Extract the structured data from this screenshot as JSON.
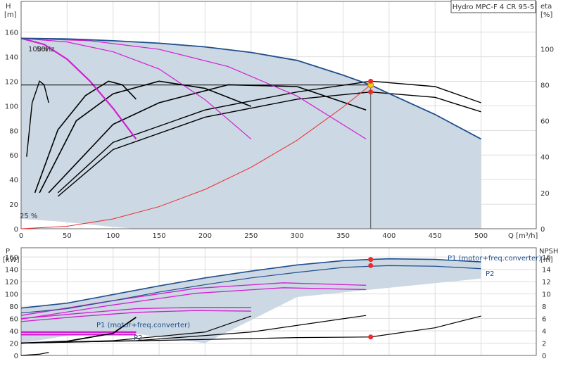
{
  "chart_data": [
    {
      "type": "line",
      "title": "Hydro MPC-F 4 CR 95-5",
      "xlabel": "Q [m³/h]",
      "ylabel_left_name": "H",
      "ylabel_left_unit": "[m]",
      "ylabel_right_name": "eta",
      "ylabel_right_unit": "[%]",
      "xlim": [
        0,
        560
      ],
      "ylim": [
        0,
        185
      ],
      "xticks": [
        0,
        50,
        100,
        150,
        200,
        250,
        300,
        350,
        400,
        450,
        500
      ],
      "yticks_left": [
        0,
        20,
        40,
        60,
        80,
        100,
        120,
        140,
        160
      ],
      "yticks_right": [
        0,
        20,
        40,
        60,
        80,
        100
      ],
      "grid": true,
      "annotations": {
        "speed_100": "100%",
        "freq_50": "50Hz",
        "speed_25": "25 %"
      },
      "max_curve": {
        "x": [
          0,
          50,
          100,
          150,
          200,
          250,
          300,
          350,
          380,
          400,
          450,
          500
        ],
        "y": [
          155,
          154.5,
          153,
          151,
          148,
          143.5,
          137,
          125,
          117,
          110,
          93,
          73
        ]
      },
      "min_curve": {
        "x": [
          0,
          10,
          20,
          30,
          40,
          60,
          80,
          100,
          125
        ],
        "y": [
          8,
          7.5,
          7,
          6.5,
          6,
          4.5,
          3,
          1.5,
          0
        ]
      },
      "pump_curves": [
        {
          "x": [
            0,
            25,
            50,
            75,
            100,
            125
          ],
          "y": [
            155,
            150,
            138,
            120,
            98,
            73
          ]
        },
        {
          "x": [
            0,
            50,
            100,
            150,
            200,
            250
          ],
          "y": [
            155,
            152,
            144,
            130,
            105,
            73
          ]
        },
        {
          "x": [
            0,
            75,
            150,
            225,
            300,
            375
          ],
          "y": [
            155,
            153,
            146,
            132,
            108,
            73
          ]
        }
      ],
      "system_curve": {
        "x": [
          0,
          50,
          100,
          150,
          200,
          250,
          300,
          350,
          380
        ],
        "y": [
          0,
          2,
          8,
          18,
          32,
          50,
          72,
          99,
          117
        ]
      },
      "setpoint_H": 117,
      "duty_point": {
        "Q": 380,
        "H": 117
      },
      "eta_curves": [
        {
          "x": [
            15,
            40,
            70,
            95,
            110,
            125
          ],
          "y": [
            20,
            55,
            74,
            82,
            80,
            72
          ]
        },
        {
          "x": [
            20,
            60,
            100,
            150,
            200,
            250
          ],
          "y": [
            20,
            60,
            75,
            82,
            78,
            68
          ]
        },
        {
          "x": [
            30,
            100,
            150,
            225,
            300,
            375
          ],
          "y": [
            20,
            58,
            70,
            80,
            79,
            66
          ]
        },
        {
          "x": [
            40,
            100,
            200,
            300,
            380,
            450,
            500
          ],
          "y": [
            20,
            48,
            66,
            76,
            82,
            79,
            70
          ]
        },
        {
          "x": [
            40,
            100,
            200,
            300,
            380,
            450,
            500
          ],
          "y": [
            18,
            44,
            62,
            72,
            76,
            73,
            65
          ]
        },
        {
          "x": [
            6,
            12,
            20,
            25,
            30
          ],
          "y": [
            40,
            70,
            82,
            80,
            70
          ]
        }
      ],
      "eta_duty_points": [
        82,
        76
      ]
    },
    {
      "type": "line",
      "xlabel": "",
      "ylabel_left_name": "P",
      "ylabel_left_unit": "[kW]",
      "ylabel_right_name": "NPSH",
      "ylabel_right_unit": "[m]",
      "xlim": [
        0,
        560
      ],
      "ylim": [
        0,
        175
      ],
      "yticks_left": [
        0,
        20,
        40,
        60,
        80,
        100,
        120,
        140,
        160
      ],
      "yticks_right": [
        0,
        2,
        4,
        6,
        8,
        10,
        12,
        14,
        16
      ],
      "grid": true,
      "label_p1_main": "P1 (motor+freq.converter)",
      "label_p2_main": "P2",
      "label_p1_small": "P1 (motor+freq.converter)",
      "label_p2_small": "P2",
      "p1_curve": {
        "x": [
          0,
          50,
          100,
          150,
          200,
          250,
          300,
          350,
          380,
          400,
          450,
          500
        ],
        "y": [
          77,
          85,
          99,
          113,
          126,
          137,
          147,
          154,
          156,
          157,
          156,
          152
        ]
      },
      "p2_curve": {
        "x": [
          0,
          50,
          100,
          150,
          200,
          250,
          300,
          350,
          380,
          400,
          450,
          500
        ],
        "y": [
          69,
          76,
          89,
          103,
          115,
          126,
          135,
          143,
          145,
          146,
          145,
          141
        ]
      },
      "p1_min_curve": {
        "x": [
          0,
          50,
          100,
          125
        ],
        "y": [
          20,
          32,
          35,
          35
        ]
      },
      "power_curves_mid": [
        {
          "x": [
            0,
            60,
            125,
            190,
            250
          ],
          "y": [
            60,
            68,
            76,
            78,
            78
          ]
        },
        {
          "x": [
            0,
            60,
            125,
            190,
            250
          ],
          "y": [
            55,
            63,
            70,
            73,
            72
          ]
        },
        {
          "x": [
            0,
            95,
            190,
            285,
            375
          ],
          "y": [
            65,
            88,
            109,
            118,
            114
          ]
        },
        {
          "x": [
            0,
            95,
            190,
            285,
            375
          ],
          "y": [
            59,
            81,
            101,
            110,
            107
          ]
        },
        {
          "x": [
            0,
            50,
            100,
            125
          ],
          "y": [
            38,
            38,
            38,
            38
          ]
        },
        {
          "x": [
            0,
            50,
            100,
            125
          ],
          "y": [
            34,
            34,
            34,
            34
          ]
        }
      ],
      "npsh_curves": [
        {
          "x": [
            0,
            50,
            100,
            125
          ],
          "y": [
            2,
            2.3,
            3.6,
            6.2
          ]
        },
        {
          "x": [
            0,
            100,
            200,
            250
          ],
          "y": [
            2,
            2.4,
            3.8,
            6.4
          ]
        },
        {
          "x": [
            0,
            125,
            250,
            375
          ],
          "y": [
            2,
            2.4,
            3.8,
            6.5
          ]
        },
        {
          "x": [
            0,
            100,
            200,
            300,
            380,
            450,
            500
          ],
          "y": [
            2,
            2.3,
            2.6,
            2.9,
            3.0,
            4.5,
            6.4
          ]
        },
        {
          "x": [
            0,
            20,
            30
          ],
          "y": [
            0,
            0.2,
            0.5
          ]
        }
      ],
      "duty_p1": 156,
      "duty_p2": 146,
      "duty_npsh": 3.0
    }
  ]
}
